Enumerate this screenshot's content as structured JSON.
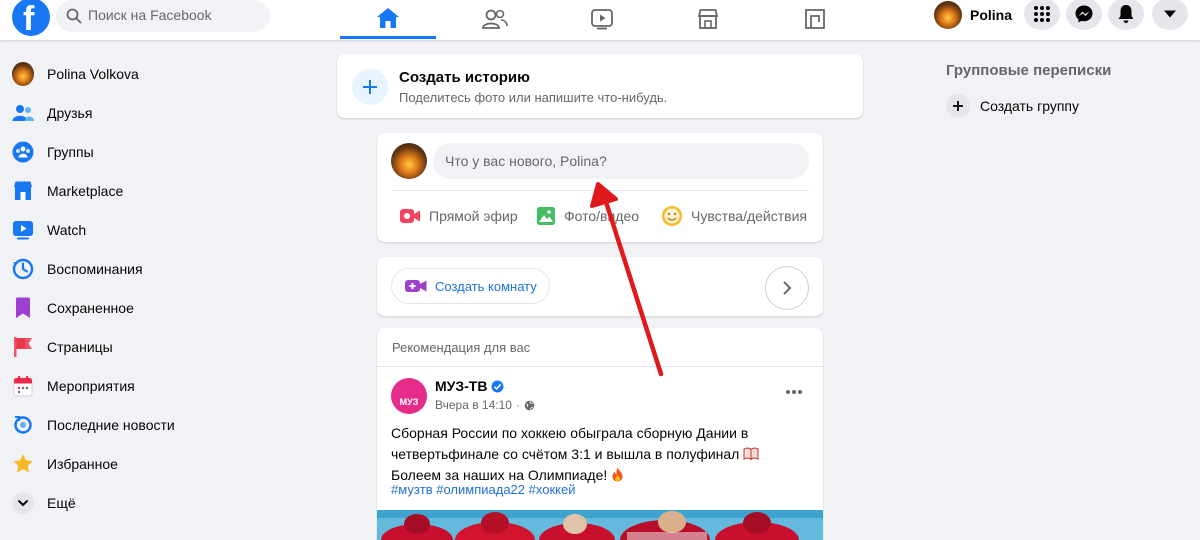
{
  "topbar": {
    "logo_letter": "f",
    "search_placeholder": "Поиск на Facebook",
    "nav_icons": [
      "home-icon",
      "friends-icon",
      "watch-icon",
      "marketplace-icon",
      "gaming-icon"
    ],
    "active_tab": "home",
    "profile_name": "Polina",
    "right_icons": [
      "menu-grid-icon",
      "messenger-icon",
      "bell-icon",
      "caret-down-icon"
    ],
    "accent_color": "#1877f2"
  },
  "sidebar": {
    "items": [
      {
        "label": "Polina Volkova",
        "icon": "avatar"
      },
      {
        "label": "Друзья",
        "icon": "friends-icon"
      },
      {
        "label": "Группы",
        "icon": "groups-icon"
      },
      {
        "label": "Marketplace",
        "icon": "marketplace-icon"
      },
      {
        "label": "Watch",
        "icon": "watch-icon"
      },
      {
        "label": "Воспоминания",
        "icon": "memories-icon"
      },
      {
        "label": "Сохраненное",
        "icon": "saved-icon"
      },
      {
        "label": "Страницы",
        "icon": "pages-icon"
      },
      {
        "label": "Мероприятия",
        "icon": "events-icon"
      },
      {
        "label": "Последние новости",
        "icon": "recent-news-icon"
      },
      {
        "label": "Избранное",
        "icon": "favorites-icon"
      },
      {
        "label": "Ещё",
        "icon": "chevron-down-icon"
      }
    ]
  },
  "story": {
    "title": "Создать историю",
    "subtitle": "Поделитесь фото или напишите что-нибудь."
  },
  "composer": {
    "placeholder": "Что у вас нового, Polina?",
    "actions": [
      {
        "label": "Прямой эфир",
        "icon": "live-video-icon",
        "color": "#f3425f"
      },
      {
        "label": "Фото/видео",
        "icon": "photo-icon",
        "color": "#45bd62"
      },
      {
        "label": "Чувства/действия",
        "icon": "feeling-icon",
        "color": "#f7b928"
      }
    ]
  },
  "rooms": {
    "create_label": "Создать комнату"
  },
  "feed": {
    "section_label": "Рекомендация для вас",
    "post": {
      "author": "МУЗ-ТВ",
      "verified": true,
      "logo_text": "МУЗ",
      "time": "Вчера в 14:10",
      "text_before_book": "Сборная России по хоккею обыграла сборную Дании в четвертьфинале со счётом 3:1 и вышла в полуфинал",
      "text_after_book": "Болеем за наших на Олимпиаде!",
      "tags": "#музтв #олимпиада22 #хоккей"
    }
  },
  "right_sidebar": {
    "title": "Групповые переписки",
    "create_group": "Создать группу"
  },
  "annotation": {
    "type": "arrow",
    "color": "#e0191b"
  }
}
